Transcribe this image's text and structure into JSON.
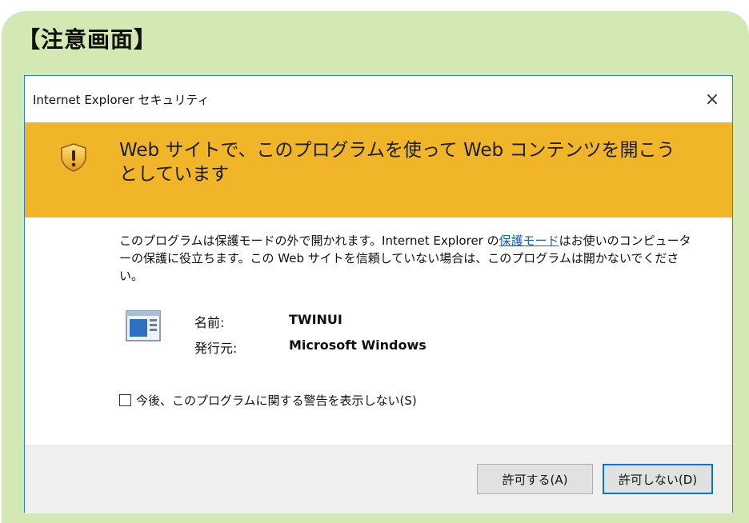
{
  "heading": "【注意画面】",
  "dialog": {
    "title": "Internet Explorer セキュリティ",
    "close_label": "×",
    "banner_text": "Web サイトで、このプログラムを使って Web コンテンツを開こうとしています",
    "description_before": "このプログラムは保護モードの外で開かれます。Internet Explorer の",
    "description_link": "保護モード",
    "description_after": "はお使いのコンピューターの保護に役立ちます。この Web サイトを信頼していない場合は、このプログラムは開かないでください。",
    "name_label": "名前:",
    "name_value": "TWINUI",
    "publisher_label": "発行元:",
    "publisher_value": "Microsoft Windows",
    "checkbox_label": "今後、このプログラムに関する警告を表示しない(S)",
    "checkbox_checked": false,
    "allow_button": "許可する(A)",
    "deny_button": "許可しない(D)"
  },
  "colors": {
    "panel_bg": "#d3e8b3",
    "banner_bg": "#f1b52a",
    "dialog_border": "#2a7dd1",
    "link": "#1a5fb4",
    "default_button_border": "#0078d7"
  },
  "icons": {
    "banner": "shield-warning-icon",
    "program": "program-window-icon",
    "close": "close-icon"
  }
}
